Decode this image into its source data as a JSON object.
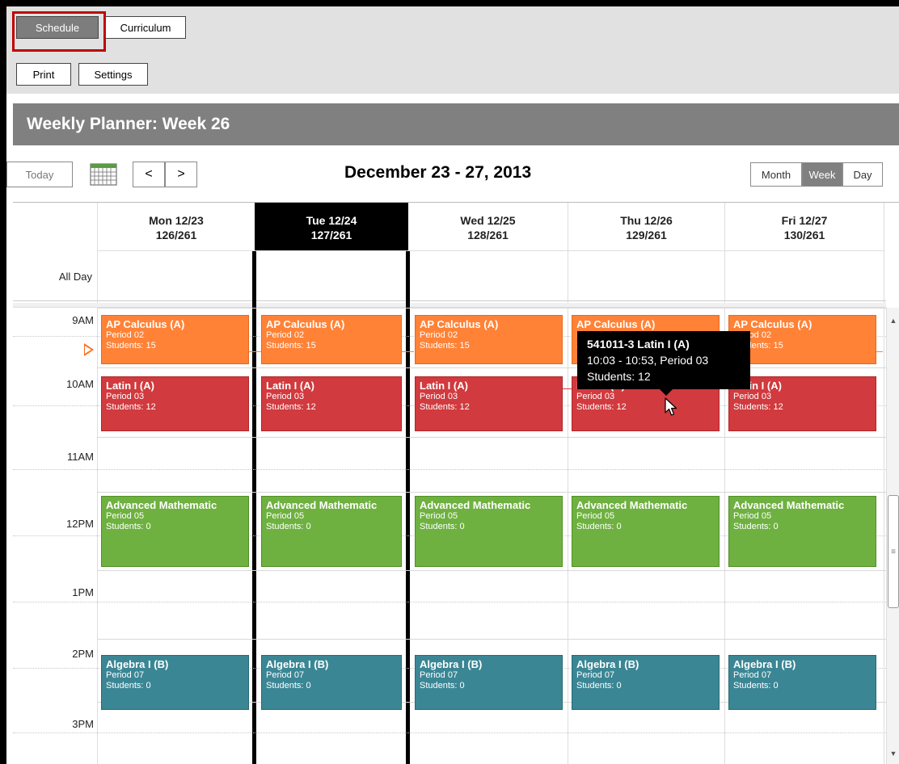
{
  "toolbar": {
    "tabs": [
      "Schedule",
      "Curriculum"
    ],
    "actions": [
      "Print",
      "Settings"
    ]
  },
  "planner": {
    "title": "Weekly Planner: Week 26",
    "today_label": "Today",
    "prev_label": "<",
    "next_label": ">",
    "date_range": "December 23 - 27, 2013",
    "views": [
      "Month",
      "Week",
      "Day"
    ],
    "active_view": "Week"
  },
  "days": [
    {
      "name": "Mon 12/23",
      "count": "126/261"
    },
    {
      "name": "Tue 12/24",
      "count": "127/261",
      "today": true
    },
    {
      "name": "Wed 12/25",
      "count": "128/261"
    },
    {
      "name": "Thu 12/26",
      "count": "129/261"
    },
    {
      "name": "Fri 12/27",
      "count": "130/261"
    }
  ],
  "all_day_label": "All Day",
  "hours": [
    "9AM",
    "10AM",
    "11AM",
    "12PM",
    "1PM",
    "2PM",
    "3PM"
  ],
  "events": [
    {
      "title": "AP Calculus (A)",
      "period": "Period 02",
      "students": "Students: 15",
      "color": "#ff8236"
    },
    {
      "title": "Latin I (A)",
      "period": "Period 03",
      "students": "Students: 12",
      "color": "#d13a3e"
    },
    {
      "title": "Advanced Mathematic",
      "period": "Period 05",
      "students": "Students: 0",
      "color": "#6fb140"
    },
    {
      "title": "Algebra I (B)",
      "period": "Period 07",
      "students": "Students: 0",
      "color": "#3b8694"
    }
  ],
  "tooltip": {
    "title": "541011-3 Latin I (A)",
    "time": "10:03 - 10:53, Period 03",
    "students": "Students: 12"
  },
  "icons": {
    "calendar": "calendar-grid-icon",
    "cursor": "mouse-pointer-icon"
  }
}
